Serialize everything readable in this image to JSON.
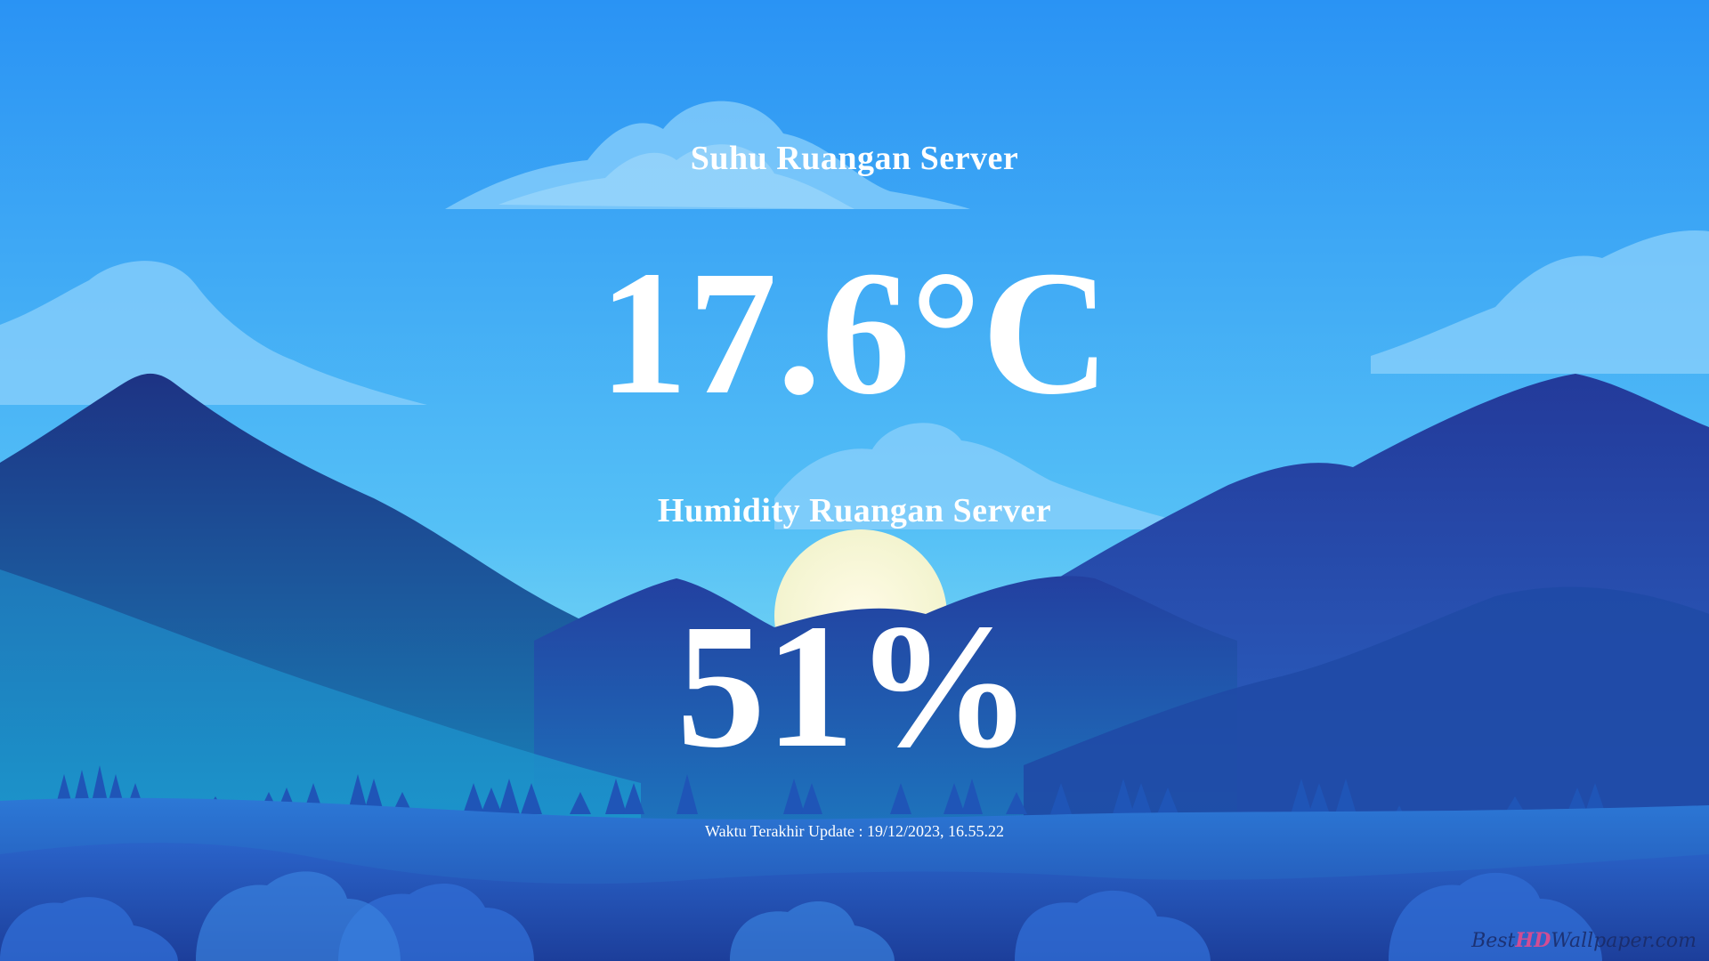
{
  "temperature": {
    "title": "Suhu Ruangan Server",
    "value": "17.6°C"
  },
  "humidity": {
    "title": "Humidity Ruangan Server",
    "value": "51%"
  },
  "last_update": {
    "text": "Waktu Terakhir Update : 19/12/2023, 16.55.22"
  },
  "watermark": {
    "prefix": "Best",
    "hd": "HD",
    "suffix": "Wallpaper.com"
  },
  "colors": {
    "sky_top": "#2b95f5",
    "sky_bottom": "#6fd5f7",
    "mountain_dark": "#1f3a8f",
    "mountain_mid": "#2b5fc0",
    "teal": "#1593c8",
    "sun": "#fbf6d8",
    "text": "#ffffff"
  }
}
